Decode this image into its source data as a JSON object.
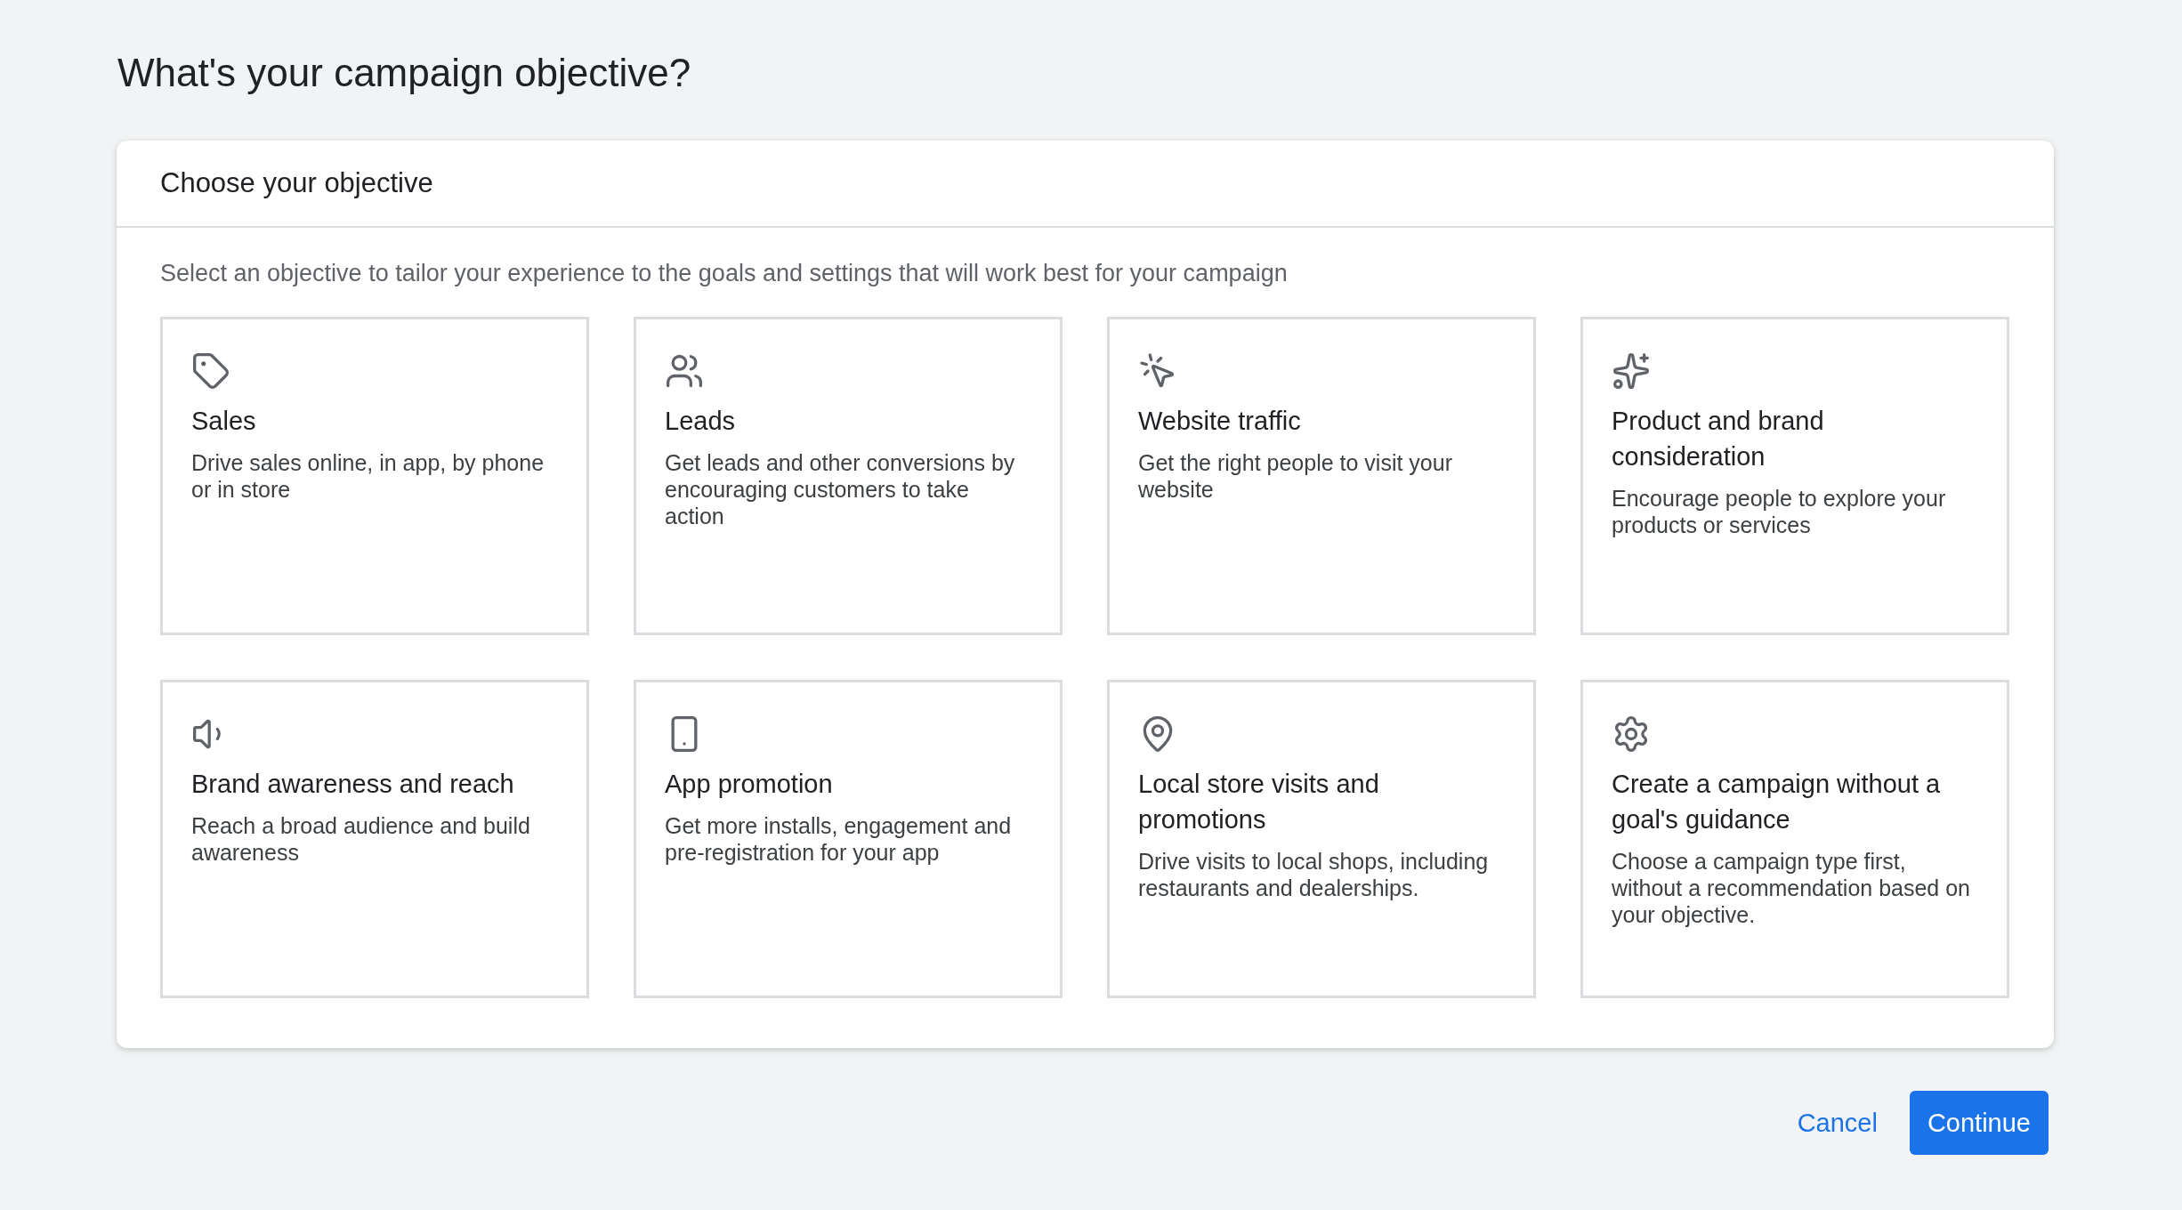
{
  "page_title": "What's your campaign objective?",
  "card": {
    "title": "Choose your objective",
    "description": "Select an objective to tailor your experience to the goals and settings that will work best for your campaign",
    "objectives": [
      {
        "title": "Sales",
        "description": "Drive sales online, in app, by phone or in store",
        "selected": false
      },
      {
        "title": "Leads",
        "description": "Get leads and other conversions by encouraging customers to take action",
        "selected": false
      },
      {
        "title": "Website traffic",
        "description": "Get the right people to visit your website",
        "selected": false
      },
      {
        "title": "Product and brand consideration",
        "description": "Encourage people to explore your products or services",
        "selected": false
      },
      {
        "title": "Brand awareness and reach",
        "description": "Reach a broad audience and build awareness",
        "selected": false
      },
      {
        "title": "App promotion",
        "description": "Get more installs, engagement and pre-registration for your app",
        "selected": false
      },
      {
        "title": "Local store visits and promotions",
        "description": "Drive visits to local shops, including restaurants and dealerships.",
        "selected": false
      },
      {
        "title": "Create a campaign without a goal's guidance",
        "description": "Choose a campaign type first, without a recommendation based on your objective.",
        "selected": false
      }
    ]
  },
  "buttons": {
    "cancel": "Cancel",
    "continue": "Continue"
  }
}
